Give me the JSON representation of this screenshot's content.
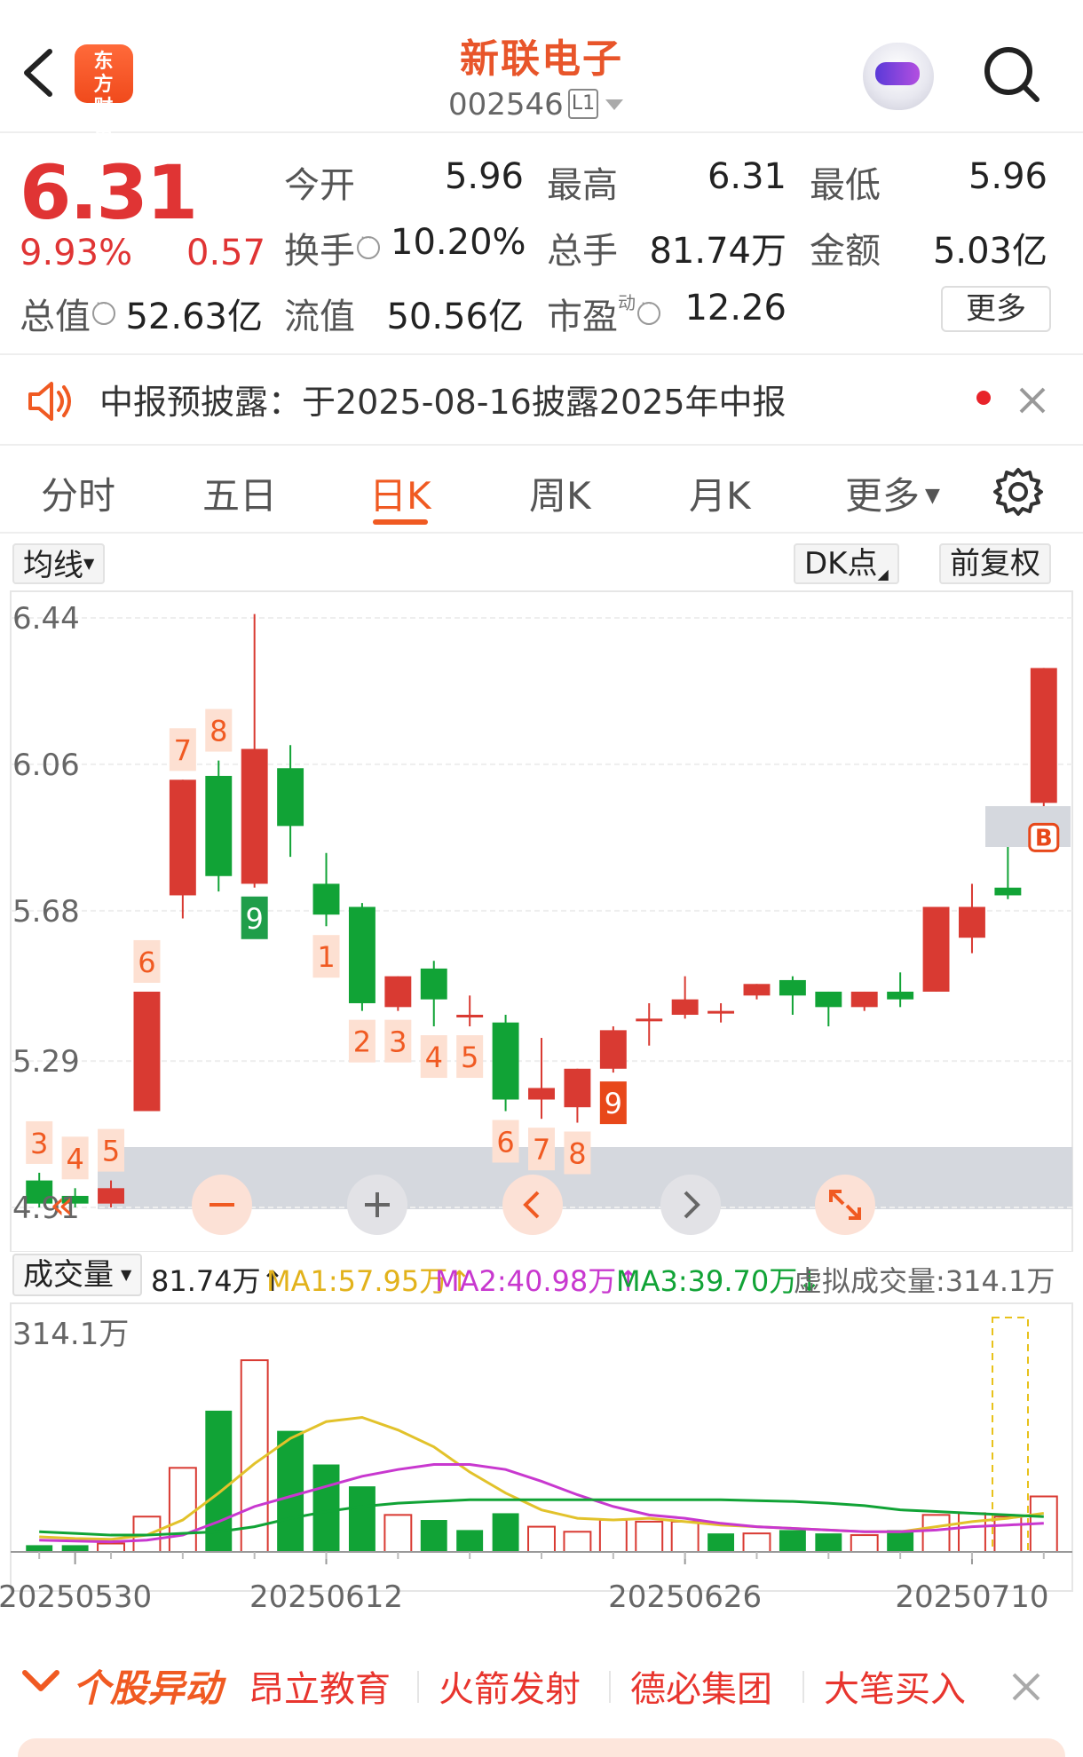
{
  "header": {
    "brand": "东方财富",
    "stock_name": "新联电子",
    "stock_code": "002546",
    "level_badge": "L1"
  },
  "quote": {
    "price": "6.31",
    "change_pct": "9.93%",
    "change": "0.57",
    "open_label": "今开",
    "open": "5.96",
    "high_label": "最高",
    "high": "6.31",
    "low_label": "最低",
    "low": "5.96",
    "turnover_label": "换手",
    "turnover": "10.20%",
    "volume_label": "总手",
    "volume": "81.74万",
    "amount_label": "金额",
    "amount": "5.03亿",
    "mktcap_label": "总值",
    "mktcap": "52.63亿",
    "float_label": "流值",
    "float_cap": "50.56亿",
    "pe_label": "市盈",
    "pe_sup": "动",
    "pe": "12.26",
    "more_label": "更多"
  },
  "notice": {
    "text": "中报预披露：于2025-08-16披露2025年中报"
  },
  "tabs": [
    "分时",
    "五日",
    "日K",
    "周K",
    "月K",
    "更多"
  ],
  "active_tab": "日K",
  "toolbar": {
    "ma_label": "均线",
    "dk_label": "DK点",
    "adjust_label": "前复权"
  },
  "colors": {
    "up": "#d93a32",
    "down": "#11a336",
    "accent": "#f05a22",
    "ma1": "#e2c22b",
    "ma2": "#c838cf",
    "ma3": "#11a336"
  },
  "chart_data": {
    "type": "candlestick",
    "y_ticks": [
      "6.44",
      "6.06",
      "5.68",
      "5.29",
      "4.91"
    ],
    "ylim": [
      4.91,
      6.44
    ],
    "candles": [
      {
        "o": 4.98,
        "c": 4.92,
        "h": 5.0,
        "l": 4.91,
        "label": "3",
        "label_pos": "above"
      },
      {
        "o": 4.94,
        "c": 4.92,
        "h": 4.96,
        "l": 4.91,
        "label": "4",
        "label_pos": "above"
      },
      {
        "o": 4.92,
        "c": 4.96,
        "h": 4.98,
        "l": 4.91,
        "label": "5",
        "label_pos": "above"
      },
      {
        "o": 5.16,
        "c": 5.47,
        "h": 5.47,
        "l": 5.16,
        "label": "6",
        "label_pos": "above"
      },
      {
        "o": 5.72,
        "c": 6.02,
        "h": 6.02,
        "l": 5.66,
        "label": "7",
        "label_pos": "above"
      },
      {
        "o": 6.03,
        "c": 5.77,
        "h": 6.07,
        "l": 5.73,
        "label": "8",
        "label_pos": "above"
      },
      {
        "o": 5.75,
        "c": 6.1,
        "h": 6.45,
        "l": 5.74,
        "label": "9",
        "label_pos": "below",
        "label_color": "green"
      },
      {
        "o": 6.05,
        "c": 5.9,
        "h": 6.11,
        "l": 5.82,
        "label": "",
        "label_pos": "above"
      },
      {
        "o": 5.75,
        "c": 5.67,
        "h": 5.83,
        "l": 5.64,
        "label": "1",
        "label_pos": "below"
      },
      {
        "o": 5.69,
        "c": 5.44,
        "h": 5.7,
        "l": 5.42,
        "label": "2",
        "label_pos": "below"
      },
      {
        "o": 5.43,
        "c": 5.51,
        "h": 5.51,
        "l": 5.42,
        "label": "3",
        "label_pos": "below"
      },
      {
        "o": 5.53,
        "c": 5.45,
        "h": 5.55,
        "l": 5.38,
        "label": "4",
        "label_pos": "below"
      },
      {
        "o": 5.41,
        "c": 5.41,
        "h": 5.46,
        "l": 5.38,
        "label": "5",
        "label_pos": "below"
      },
      {
        "o": 5.39,
        "c": 5.19,
        "h": 5.41,
        "l": 5.16,
        "label": "6",
        "label_pos": "below"
      },
      {
        "o": 5.19,
        "c": 5.22,
        "h": 5.35,
        "l": 5.14,
        "label": "7",
        "label_pos": "below"
      },
      {
        "o": 5.17,
        "c": 5.27,
        "h": 5.27,
        "l": 5.13,
        "label": "8",
        "label_pos": "below"
      },
      {
        "o": 5.27,
        "c": 5.37,
        "h": 5.38,
        "l": 5.26,
        "label": "9",
        "label_pos": "below",
        "label_color": "red"
      },
      {
        "o": 5.4,
        "c": 5.4,
        "h": 5.44,
        "l": 5.33,
        "label": ""
      },
      {
        "o": 5.41,
        "c": 5.45,
        "h": 5.51,
        "l": 5.4,
        "label": ""
      },
      {
        "o": 5.42,
        "c": 5.42,
        "h": 5.44,
        "l": 5.39,
        "label": ""
      },
      {
        "o": 5.46,
        "c": 5.49,
        "h": 5.49,
        "l": 5.45,
        "label": ""
      },
      {
        "o": 5.5,
        "c": 5.46,
        "h": 5.51,
        "l": 5.41,
        "label": ""
      },
      {
        "o": 5.47,
        "c": 5.43,
        "h": 5.47,
        "l": 5.38,
        "label": ""
      },
      {
        "o": 5.43,
        "c": 5.47,
        "h": 5.47,
        "l": 5.42,
        "label": ""
      },
      {
        "o": 5.47,
        "c": 5.45,
        "h": 5.52,
        "l": 5.43,
        "label": ""
      },
      {
        "o": 5.47,
        "c": 5.69,
        "h": 5.69,
        "l": 5.47,
        "label": ""
      },
      {
        "o": 5.61,
        "c": 5.69,
        "h": 5.75,
        "l": 5.57,
        "label": ""
      },
      {
        "o": 5.74,
        "c": 5.72,
        "h": 5.87,
        "l": 5.71,
        "label": ""
      },
      {
        "o": 5.96,
        "c": 6.31,
        "h": 6.31,
        "l": 5.96,
        "label": "B",
        "label_pos": "below_marker"
      }
    ],
    "volume_ylim": [
      0,
      314.1
    ],
    "volume_top_label": "314.1万",
    "volumes": [
      {
        "v": 8,
        "up": false
      },
      {
        "v": 8,
        "up": false
      },
      {
        "v": 10,
        "up": true
      },
      {
        "v": 42,
        "up": true
      },
      {
        "v": 100,
        "up": true
      },
      {
        "v": 168,
        "up": false
      },
      {
        "v": 228,
        "up": true
      },
      {
        "v": 144,
        "up": false
      },
      {
        "v": 104,
        "up": false
      },
      {
        "v": 78,
        "up": false
      },
      {
        "v": 44,
        "up": true
      },
      {
        "v": 38,
        "up": false
      },
      {
        "v": 26,
        "up": false
      },
      {
        "v": 46,
        "up": false
      },
      {
        "v": 30,
        "up": true
      },
      {
        "v": 24,
        "up": true
      },
      {
        "v": 38,
        "up": true
      },
      {
        "v": 36,
        "up": true
      },
      {
        "v": 36,
        "up": true
      },
      {
        "v": 22,
        "up": false
      },
      {
        "v": 22,
        "up": true
      },
      {
        "v": 26,
        "up": false
      },
      {
        "v": 22,
        "up": false
      },
      {
        "v": 20,
        "up": true
      },
      {
        "v": 26,
        "up": false
      },
      {
        "v": 44,
        "up": true
      },
      {
        "v": 46,
        "up": true
      },
      {
        "v": 42,
        "up": true
      },
      {
        "v": 66,
        "up": true
      }
    ],
    "ma1": [
      18,
      16,
      15,
      20,
      38,
      70,
      105,
      135,
      155,
      160,
      145,
      125,
      95,
      70,
      50,
      40,
      38,
      40,
      36,
      32,
      30,
      28,
      26,
      24,
      24,
      30,
      36,
      40,
      46
    ],
    "ma2": [
      14,
      13,
      12,
      14,
      20,
      36,
      54,
      66,
      78,
      90,
      98,
      104,
      104,
      98,
      84,
      68,
      54,
      44,
      40,
      34,
      30,
      28,
      26,
      24,
      24,
      26,
      30,
      32,
      34
    ],
    "ma3": [
      24,
      22,
      20,
      20,
      22,
      24,
      30,
      40,
      48,
      54,
      58,
      60,
      62,
      62,
      62,
      62,
      62,
      62,
      62,
      62,
      61,
      60,
      58,
      55,
      50,
      48,
      46,
      44,
      42
    ],
    "x_ticks": [
      "20250530",
      "20250612",
      "20250626",
      "20250710"
    ]
  },
  "volume_legend": {
    "selector_label": "成交量",
    "vol": "81.74万",
    "ma1": "MA1:57.95万",
    "ma2": "MA2:40.98万",
    "ma3": "MA3:39.70万",
    "virtual": "虚拟成交量:314.1万"
  },
  "hot": {
    "title": "个股异动",
    "items": [
      "昂立教育",
      "火箭发射",
      "德必集团",
      "大笔买入"
    ]
  }
}
